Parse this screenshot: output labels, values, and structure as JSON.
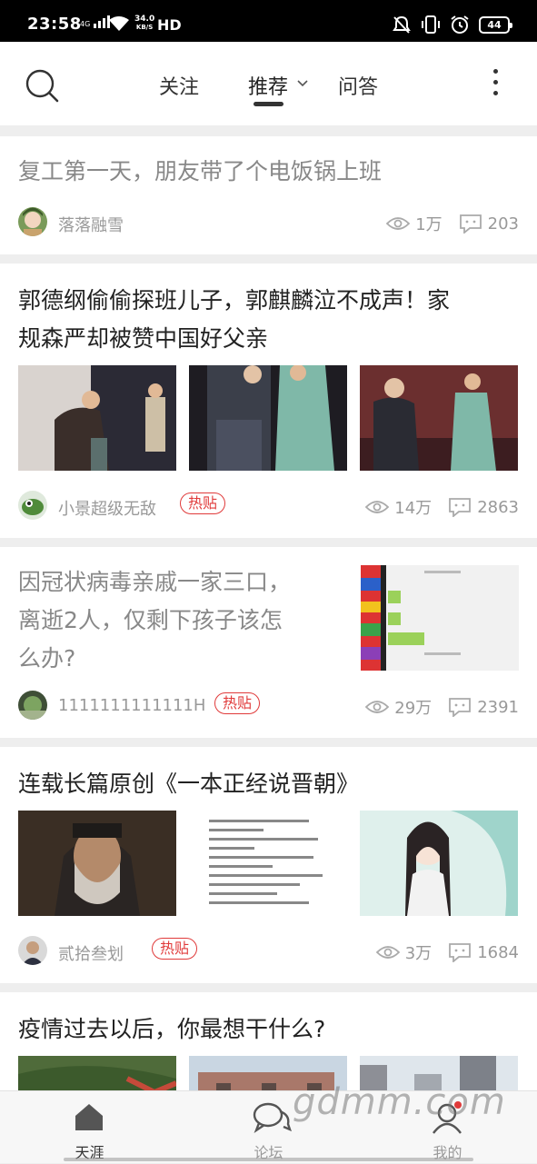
{
  "status_bar": {
    "time": "23:58",
    "network": "4G",
    "speed_value": "34.0",
    "speed_unit": "KB/S",
    "hd": "HD",
    "battery": "44"
  },
  "top_nav": {
    "tabs": [
      {
        "label": "关注"
      },
      {
        "label": "推荐"
      },
      {
        "label": "问答"
      }
    ],
    "active_tab": "推荐"
  },
  "feed": [
    {
      "title": "复工第一天，朋友带了个电饭锅上班",
      "read": true,
      "author": "落落融雪",
      "views": "1万",
      "comments": "203"
    },
    {
      "title_line1": "郭德纲偷偷探班儿子，郭麒麟泣不成声！家",
      "title_line2": "规森严却被赞中国好父亲",
      "author": "小景超级无敌",
      "badge": "热贴",
      "views": "14万",
      "comments": "2863"
    },
    {
      "title_line1": "因冠状病毒亲戚一家三口，",
      "title_line2": "离逝2人，仅剩下孩子该怎",
      "title_line3": "么办?",
      "read": true,
      "author": "1111111111111H",
      "badge": "热贴",
      "views": "29万",
      "comments": "2391"
    },
    {
      "title": "连载长篇原创《一本正经说晋朝》",
      "author": "贰拾叁划",
      "badge": "热贴",
      "views": "3万",
      "comments": "1684"
    },
    {
      "title": "疫情过去以后，你最想干什么?"
    }
  ],
  "bottom_nav": {
    "items": [
      {
        "label": "天涯"
      },
      {
        "label": "论坛"
      },
      {
        "label": "我的"
      }
    ]
  },
  "watermark": "gdmm.com",
  "colors": {
    "hot_badge": "#e03a3a",
    "muted_text": "#999999",
    "title_text": "#222222"
  }
}
